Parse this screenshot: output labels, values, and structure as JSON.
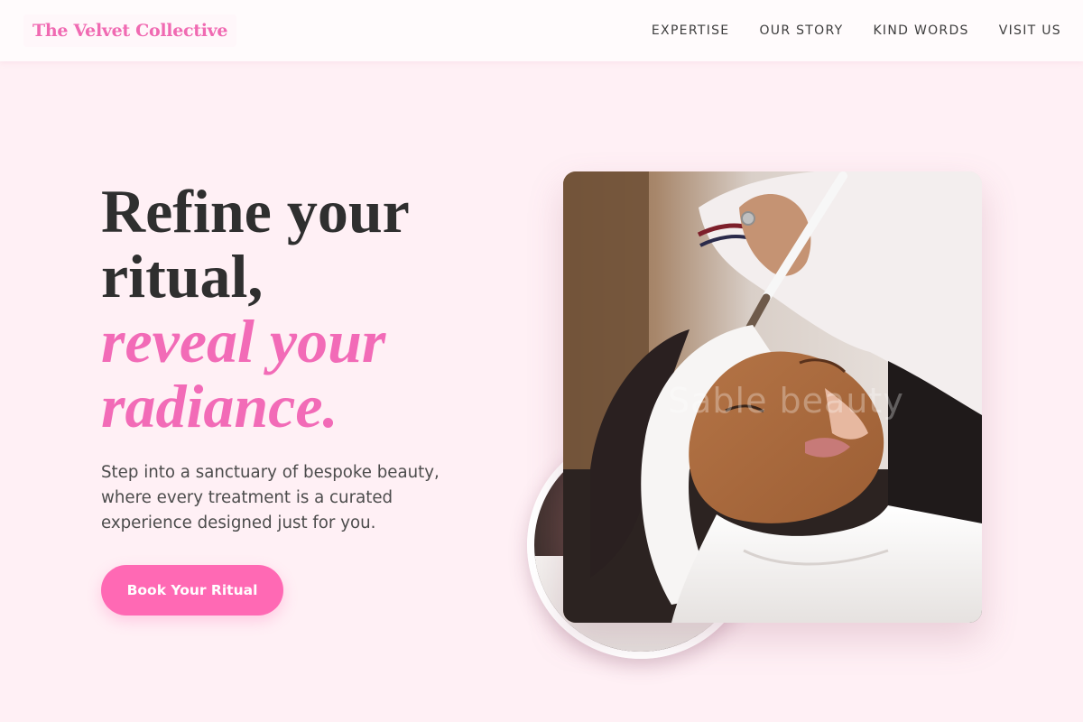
{
  "brand": {
    "name": "The Velvet Collective"
  },
  "nav": {
    "items": [
      {
        "label": "EXPERTISE"
      },
      {
        "label": "OUR STORY"
      },
      {
        "label": "KIND WORDS"
      },
      {
        "label": "VISIT US"
      }
    ]
  },
  "hero": {
    "title_line1": "Refine your",
    "title_line2": "ritual,",
    "title_accent_line1": "reveal your",
    "title_accent_line2": "radiance.",
    "subtitle": "Step into a sanctuary of bespoke beauty, where every treatment is a curated experience designed just for you.",
    "cta_label": "Book Your Ritual"
  },
  "media": {
    "main_image_watermark": "Sable beauty",
    "main_image_subject": "woman receiving a clay face mask treatment with a brush",
    "accent_image_subject": "circular inset photo"
  },
  "colors": {
    "accent": "#ff69b4",
    "accent_text": "#f26bb7",
    "background": "#fff0f5",
    "heading": "#2f2f2f"
  }
}
